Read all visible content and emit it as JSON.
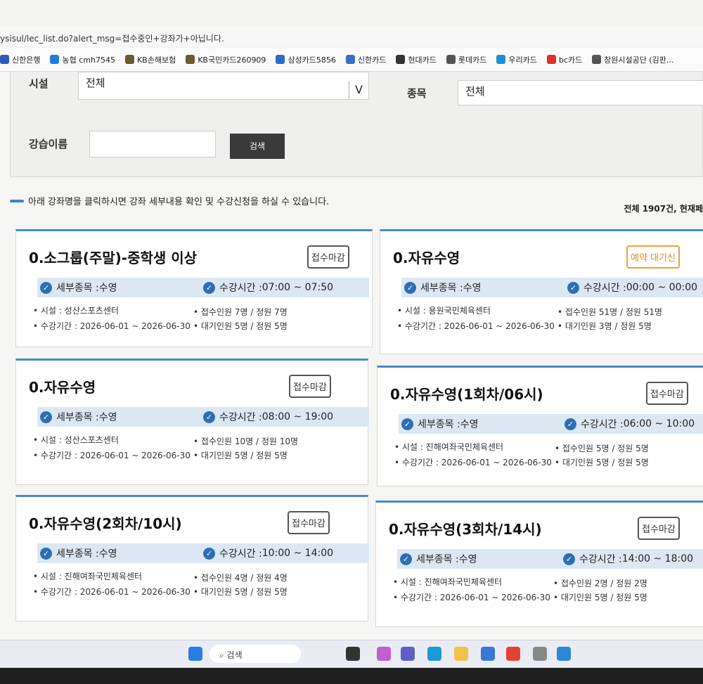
{
  "browser": {
    "url": "ysisul/lec_list.do?alert_msg=접수중인+강좌가+아닙니다.",
    "bookmarks": [
      {
        "label": "신한은행",
        "color": "#2a5cb8"
      },
      {
        "label": "농협 cmh7545",
        "color": "#1e7be0"
      },
      {
        "label": "KB손해보험",
        "color": "#6b5a2e"
      },
      {
        "label": "KB국민카드260909",
        "color": "#6b5a2e"
      },
      {
        "label": "삼성카드5856",
        "color": "#2b6ac9"
      },
      {
        "label": "신한카드",
        "color": "#3a6fc4"
      },
      {
        "label": "현대카드",
        "color": "#333333"
      },
      {
        "label": "롯데카드",
        "color": "#555555"
      },
      {
        "label": "우리카드",
        "color": "#1b8fd6"
      },
      {
        "label": "bc카드",
        "color": "#e0302a"
      },
      {
        "label": "창원시설공단 (김판...",
        "color": "#555555"
      }
    ]
  },
  "search": {
    "facility_label": "시설",
    "facility_value": "전체",
    "dropdown_arrow": "V",
    "sport_label": "종목",
    "sport_value": "전체",
    "lecture_label": "강습이름",
    "lecture_value": "",
    "search_button": "검색"
  },
  "notice": "아래 강좌명을 클릭하시면 강좌 세부내용 확인 및 수강신청을 하실 수 있습니다.",
  "total": "전체 1907건, 현재페",
  "labels": {
    "sport_prefix": "세부종목 : ",
    "time_prefix": "수강시간 : ",
    "facility_prefix": "• 시설 : ",
    "period_prefix": "• 수강기간 : ",
    "enroll_prefix": "• 접수인원 ",
    "wait_prefix": "• 대기인원 "
  },
  "cards": [
    {
      "title": "0.소그룹(주말)-중학생 이상",
      "status": "접수마감",
      "status_type": "closed",
      "sport": "수영",
      "time": "07:00 ~ 07:50",
      "facility": "성산스포츠센터",
      "period": "2026-06-01 ~ 2026-06-30",
      "enroll": "7명 / 정원 7명",
      "wait": "5명 / 정원 5명"
    },
    {
      "title": "0.자유수영",
      "status": "예약 대기신",
      "status_type": "wait",
      "sport": "수영",
      "time": "00:00 ~ 00:00",
      "facility": "용원국민체육센터",
      "period": "2026-06-01 ~ 2026-06-30",
      "enroll": "51명 / 정원 51명",
      "wait": "3명 / 정원 5명"
    },
    {
      "title": "0.자유수영",
      "status": "접수마감",
      "status_type": "closed",
      "sport": "수영",
      "time": "08:00 ~ 19:00",
      "facility": "성산스포츠센터",
      "period": "2026-06-01 ~ 2026-06-30",
      "enroll": "10명 / 정원 10명",
      "wait": "5명 / 정원 5명"
    },
    {
      "title": "0.자유수영(1회차/06시)",
      "status": "접수마감",
      "status_type": "closed",
      "sport": "수영",
      "time": "06:00 ~ 10:00",
      "facility": "진해여좌국민체육센터",
      "period": "2026-06-01 ~ 2026-06-30",
      "enroll": "5명 / 정원 5명",
      "wait": "5명 / 정원 5명"
    },
    {
      "title": "0.자유수영(2회차/10시)",
      "status": "접수마감",
      "status_type": "closed",
      "sport": "수영",
      "time": "10:00 ~ 14:00",
      "facility": "진해여좌국민체육센터",
      "period": "2026-06-01 ~ 2026-06-30",
      "enroll": "4명 / 정원 4명",
      "wait": "5명 / 정원 5명"
    },
    {
      "title": "0.자유수영(3회차/14시)",
      "status": "접수마감",
      "status_type": "closed",
      "sport": "수영",
      "time": "14:00 ~ 18:00",
      "facility": "진해여좌국민체육센터",
      "period": "2026-06-01 ~ 2026-06-30",
      "enroll": "2명 / 정원 2명",
      "wait": "5명 / 정원 5명"
    }
  ],
  "taskbar": {
    "search_label": "검색",
    "search_icon": "magnifier-icon",
    "apps": [
      {
        "name": "windows-start-icon",
        "color": "#2a7de1"
      },
      {
        "name": "taskview-icon",
        "color": "#333333"
      },
      {
        "name": "copilot-icon",
        "color": "#c060d0"
      },
      {
        "name": "teams-icon",
        "color": "#5b5fc7"
      },
      {
        "name": "edge-icon",
        "color": "#1a9bd7"
      },
      {
        "name": "explorer-icon",
        "color": "#f2c14b"
      },
      {
        "name": "store-icon",
        "color": "#3a78d8"
      },
      {
        "name": "chrome-icon",
        "color": "#e34133"
      },
      {
        "name": "app-icon",
        "color": "#888888"
      },
      {
        "name": "remote-icon",
        "color": "#2b88d8"
      }
    ]
  }
}
